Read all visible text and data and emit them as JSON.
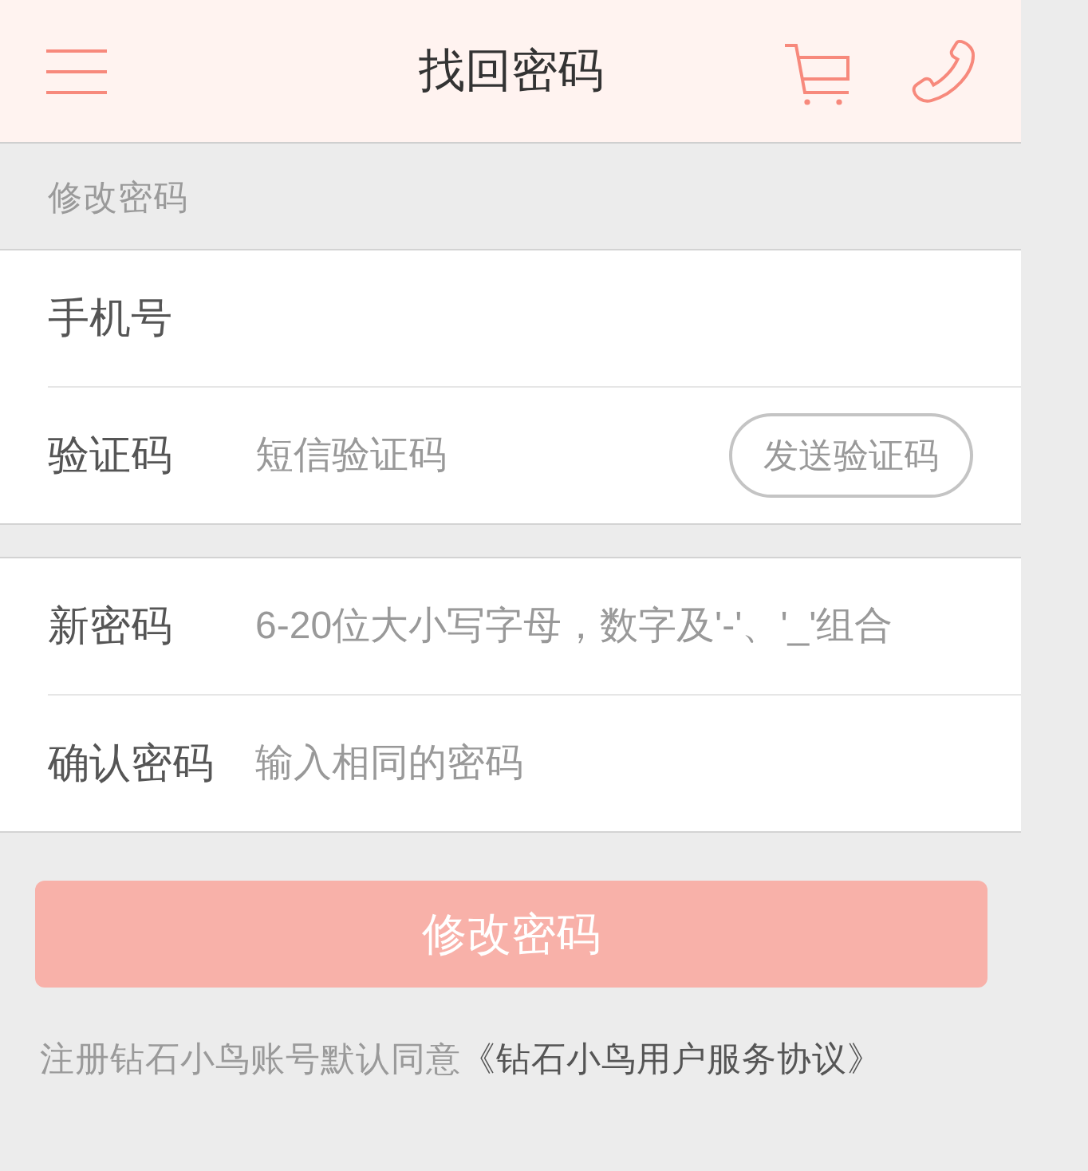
{
  "header": {
    "title": "找回密码"
  },
  "section_label": "修改密码",
  "field_groups": [
    {
      "fields": [
        {
          "kind": "text",
          "label": "手机号"
        },
        {
          "kind": "code",
          "label": "验证码",
          "placeholder": "短信验证码",
          "action": "发送验证码"
        }
      ]
    },
    {
      "fields": [
        {
          "kind": "text",
          "label": "新密码",
          "placeholder": "6-20位大小写字母，数字及'-'、'_'组合"
        },
        {
          "kind": "text",
          "label": "确认密码",
          "placeholder": "输入相同的密码"
        }
      ]
    }
  ],
  "submit_button": "修改密码",
  "agreement": {
    "text": "注册钻石小鸟账号默认同意",
    "link": "《钻石小鸟用户服务协议》"
  }
}
